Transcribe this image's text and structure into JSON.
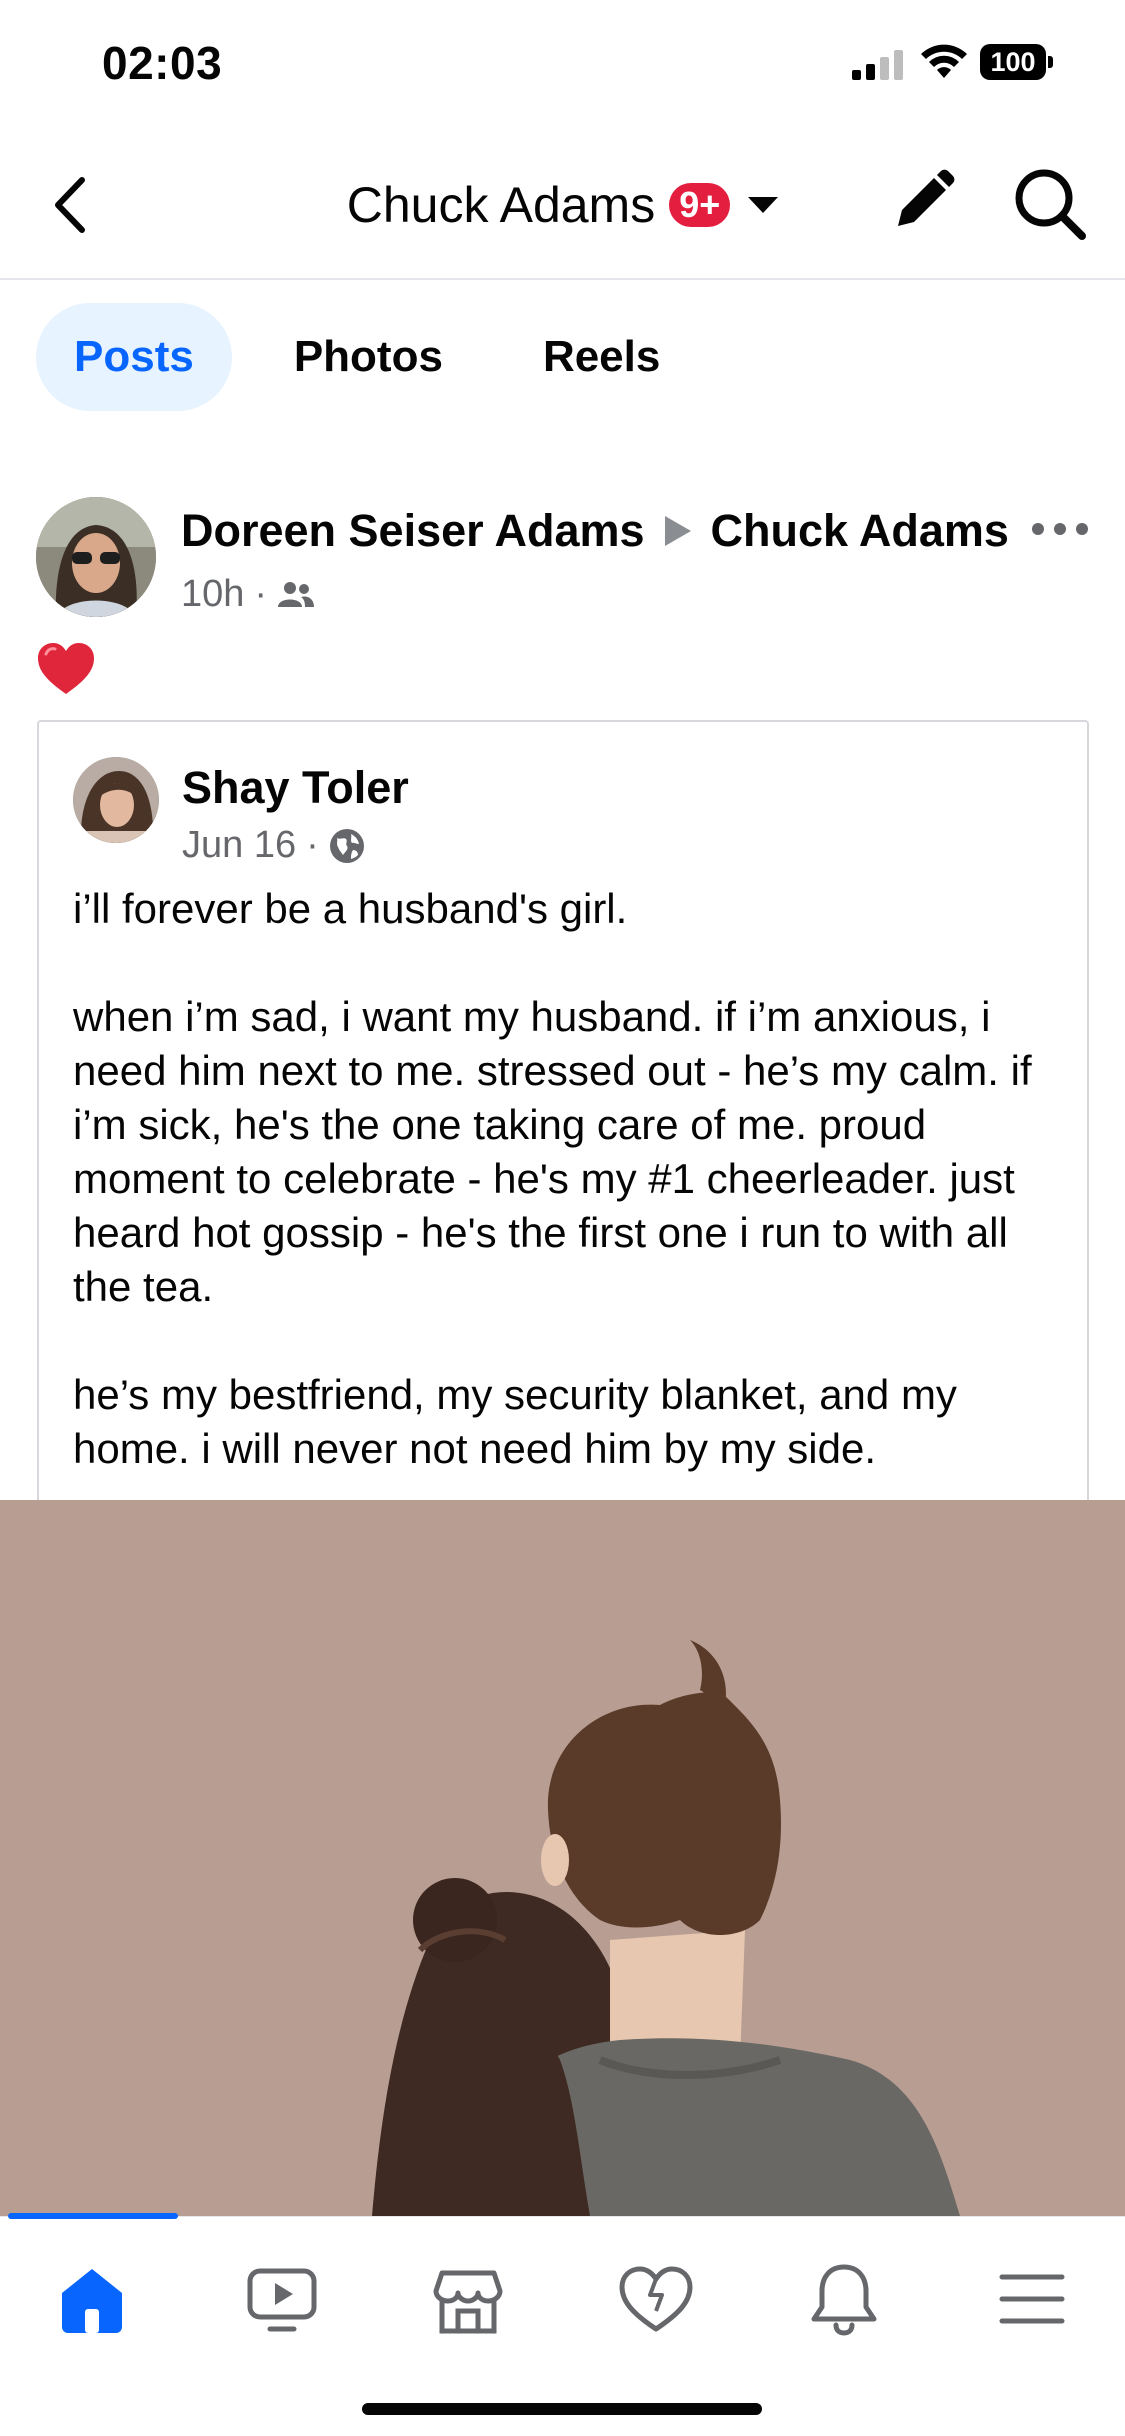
{
  "status_bar": {
    "time": "02:03",
    "battery": "100",
    "icons": [
      "signal-icon",
      "wifi-icon",
      "battery-icon"
    ]
  },
  "top_nav": {
    "title": "Chuck Adams",
    "badge": "9+",
    "icons": [
      "back-icon",
      "chevron-down-icon",
      "edit-icon",
      "search-icon"
    ],
    "accent_color": "#e41e3f"
  },
  "tabs": [
    {
      "label": "Posts",
      "active": true
    },
    {
      "label": "Photos",
      "active": false
    },
    {
      "label": "Reels",
      "active": false
    }
  ],
  "post": {
    "author": "Doreen Seiser Adams",
    "target": "Chuck Adams",
    "time": "10h",
    "audience_icon": "friends-icon",
    "reaction_icon": "red-heart-icon",
    "shared": {
      "author": "Shay Toler",
      "date": "Jun 16",
      "audience_icon": "globe-icon",
      "text": "i’ll forever be a husband's girl.\n\nwhen i’m sad, i want my husband. if i’m anxious, i need him next to me. stressed out - he’s my calm. if i’m sick, he's the one taking care of me. proud moment to celebrate - he's my #1 cheerleader. just heard hot gossip - he's the first one i run to with all the tea.\n\nhe’s my bestfriend, my security blanket, and my home. i will never not need him by my side."
    }
  },
  "bottom_nav": {
    "items": [
      "home-icon",
      "video-icon",
      "marketplace-icon",
      "dating-heart-icon",
      "notifications-bell-icon",
      "menu-icon"
    ],
    "active": "home-icon",
    "brand_color": "#0866ff"
  }
}
